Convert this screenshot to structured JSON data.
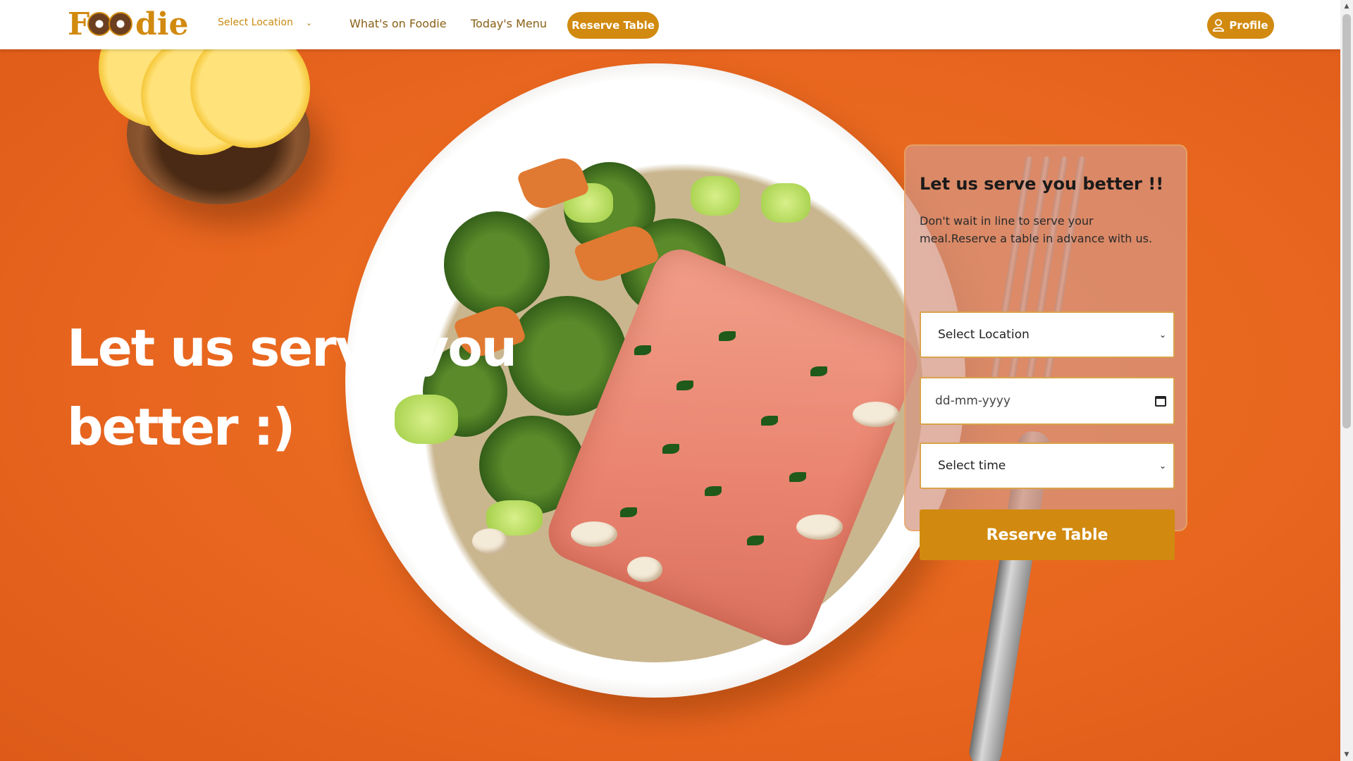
{
  "brand": {
    "logo_text": "Foodie",
    "logo_head": "F",
    "logo_tail": "die",
    "accent": "#d18a0f",
    "hero_bg": "#e8661f"
  },
  "nav": {
    "location_select": "Select Location",
    "links": [
      "What's on Foodie",
      "Today's Menu"
    ],
    "reserve_label": "Reserve Table",
    "profile_label": "Profile"
  },
  "hero": {
    "headline": "Let us serve you better :)"
  },
  "card": {
    "title": "Let us serve you better !!",
    "description": "Don't wait in line to serve your meal.Reserve a table in advance with us.",
    "location_select": "Select Location",
    "date_placeholder": "dd-mm-yyyy",
    "time_select": "Select time",
    "submit_label": "Reserve Table"
  },
  "icons": {
    "chevron": "chevron-down-icon",
    "profile": "user-icon",
    "calendar": "calendar-icon"
  }
}
